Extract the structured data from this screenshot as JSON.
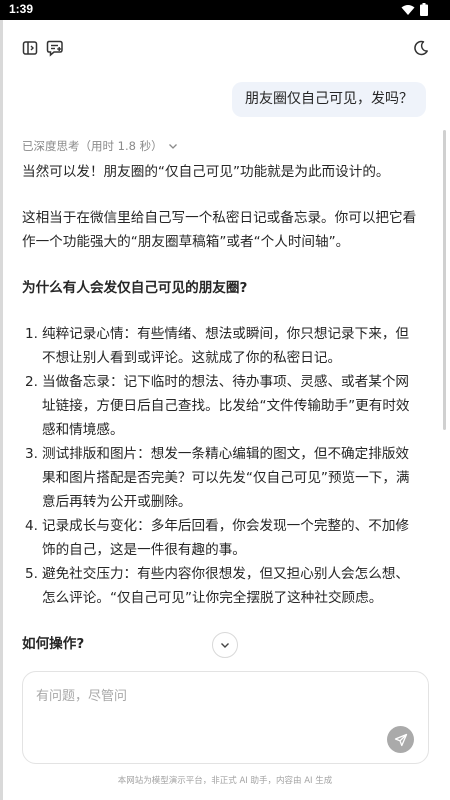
{
  "status_bar": {
    "time": "1:39"
  },
  "conversation": {
    "user_message": "朋友圈仅自己可见，发吗？",
    "thinking_label": "已深度思考（用时 1.8 秒）",
    "answer": {
      "intro": "当然可以发！朋友圈的“仅自己可见”功能就是为此而设计的。",
      "para2": "这相当于在微信里给自己写一个私密日记或备忘录。你可以把它看作一个功能强大的“朋友圈草稿箱”或者“个人时间轴”。",
      "heading1": "为什么有人会发仅自己可见的朋友圈?",
      "reasons": [
        {
          "num": "1.",
          "text": "纯粹记录心情：有些情绪、想法或瞬间，你只想记录下来，但不想让别人看到或评论。这就成了你的私密日记。"
        },
        {
          "num": "2.",
          "text": "当做备忘录：记下临时的想法、待办事项、灵感、或者某个网址链接，方便日后自己查找。比发给“文件传输助手”更有时效感和情境感。"
        },
        {
          "num": "3.",
          "text": "测试排版和图片：想发一条精心编辑的图文，但不确定排版效果和图片搭配是否完美？可以先发“仅自己可见”预览一下，满意后再转为公开或删除。"
        },
        {
          "num": "4.",
          "text": "记录成长与变化：多年后回看，你会发现一个完整的、不加修饰的自己，这是一件很有趣的事。"
        },
        {
          "num": "5.",
          "text": "避免社交压力：有些内容你很想发，但又担心别人会怎么想、怎么评论。“仅自己可见”让你完全摆脱了这种社交顾虑。"
        }
      ],
      "heading2": "如何操作?"
    }
  },
  "composer": {
    "placeholder": "有问题，尽管问"
  },
  "footer": {
    "disclaimer": "本网站为模型演示平台，非正式 AI 助手，内容由 AI 生成"
  },
  "colors": {
    "user_bubble_bg": "#eff3fa",
    "send_button": "#aaaaaa"
  },
  "icons": [
    "sidebar-icon",
    "new-chat-icon",
    "moon-icon",
    "chevron-down-icon",
    "arrow-down-icon",
    "send-icon",
    "wifi-icon",
    "battery-icon"
  ]
}
